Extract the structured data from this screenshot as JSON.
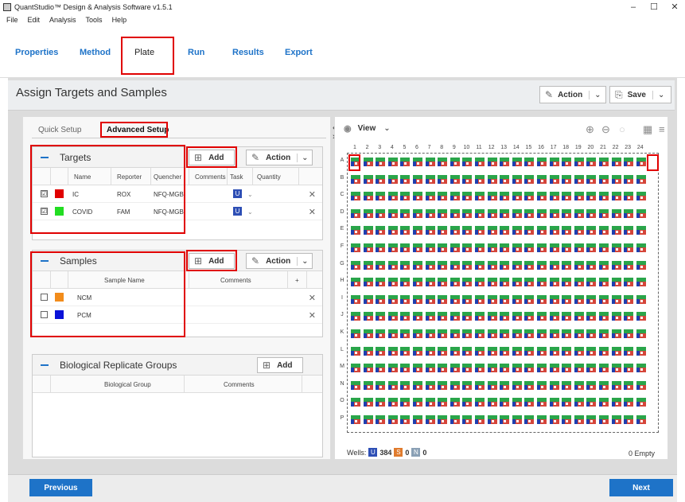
{
  "window": {
    "title": "QuantStudio™ Design & Analysis Software v1.5.1"
  },
  "menu": [
    "File",
    "Edit",
    "Analysis",
    "Tools",
    "Help"
  ],
  "nav_tabs": [
    "Properties",
    "Method",
    "Plate",
    "Run",
    "Results",
    "Export"
  ],
  "header": {
    "title": "Assign Targets and Samples",
    "action_label": "Action",
    "save_label": "Save"
  },
  "subtabs": {
    "quick": "Quick Setup",
    "advanced": "Advanced Setup"
  },
  "targets": {
    "title": "Targets",
    "add_label": "Add",
    "action_label": "Action",
    "columns": [
      "Name",
      "Reporter",
      "Quencher",
      "Comments",
      "Task",
      "Quantity"
    ],
    "rows": [
      {
        "name": "IC",
        "reporter": "ROX",
        "quencher": "NFQ-MGB",
        "color": "#e00000",
        "task_icon": "U",
        "checked": "☑"
      },
      {
        "name": "COVID",
        "reporter": "FAM",
        "quencher": "NFQ-MGB",
        "color": "#22dd22",
        "task_icon": "U",
        "checked": "☑"
      }
    ]
  },
  "samples": {
    "title": "Samples",
    "add_label": "Add",
    "action_label": "Action",
    "columns": [
      "Sample Name",
      "Comments",
      "+"
    ],
    "rows": [
      {
        "name": "NCM",
        "color": "#f28c1b"
      },
      {
        "name": "PCM",
        "color": "#0a12d8"
      }
    ]
  },
  "bio_groups": {
    "title": "Biological Replicate Groups",
    "add_label": "Add",
    "columns": [
      "Biological Group",
      "Comments"
    ]
  },
  "plate": {
    "view_label": "View",
    "columns": [
      "1",
      "2",
      "3",
      "4",
      "5",
      "6",
      "7",
      "8",
      "9",
      "10",
      "11",
      "12",
      "13",
      "14",
      "15",
      "16",
      "17",
      "18",
      "19",
      "20",
      "21",
      "22",
      "23",
      "24"
    ],
    "rows": [
      "A",
      "B",
      "C",
      "D",
      "E",
      "F",
      "G",
      "H",
      "I",
      "J",
      "K",
      "L",
      "M",
      "N",
      "O",
      "P"
    ]
  },
  "wells_legend": {
    "label": "Wells:",
    "unknown_icon": "U",
    "unknown_count": "384",
    "standard_icon": "S",
    "standard_count": "0",
    "ntc_icon": "N",
    "ntc_count": "0",
    "empty_label": "0 Empty"
  },
  "footer": {
    "previous": "Previous",
    "next": "Next"
  }
}
